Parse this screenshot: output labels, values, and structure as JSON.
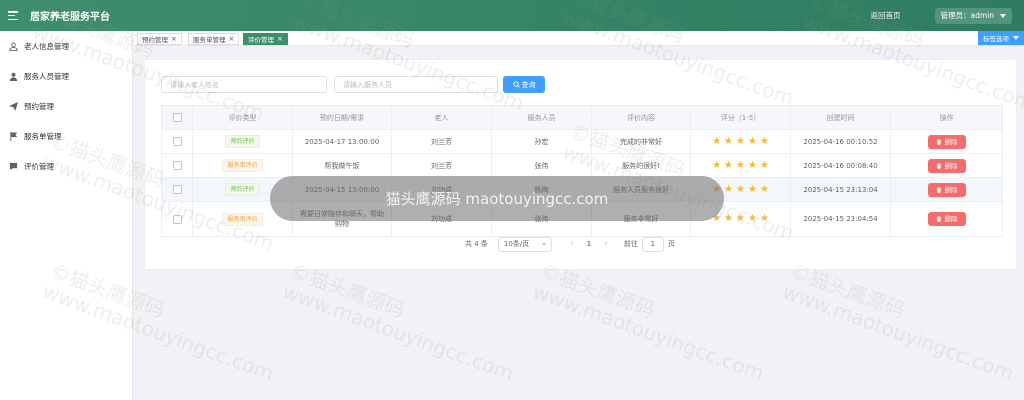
{
  "header": {
    "title": "居家养老服务平台",
    "home_link": "返回首页",
    "user_label": "管理员：admin"
  },
  "sidebar": {
    "items": [
      {
        "label": "老人信息管理",
        "icon": "user-icon"
      },
      {
        "label": "服务人员管理",
        "icon": "person-icon"
      },
      {
        "label": "预约管理",
        "icon": "send-icon"
      },
      {
        "label": "服务单管理",
        "icon": "flag-icon"
      },
      {
        "label": "评价管理",
        "icon": "comment-icon"
      }
    ]
  },
  "tabs": [
    {
      "label": "预约管理",
      "active": false
    },
    {
      "label": "服务单管理",
      "active": false
    },
    {
      "label": "评价管理",
      "active": true
    }
  ],
  "tab_options_label": "标签选项",
  "filters": {
    "elder_placeholder": "请输入老人姓名",
    "staff_placeholder": "请输入服务人员",
    "search_label": "查询"
  },
  "table": {
    "columns": [
      "评价类型",
      "预约日期/需求",
      "老人",
      "服务人员",
      "评价内容",
      "评分（1-5）",
      "创建时间",
      "操作"
    ],
    "rows": [
      {
        "type": "预约评价",
        "type_color": "green",
        "date_need": "2025-04-17 13:00:00",
        "elder": "刘兰芳",
        "staff": "孙宏",
        "content": "完成的非常好",
        "rating": 5,
        "created": "2025-04-16 00:10:52",
        "action": "删除"
      },
      {
        "type": "服务单评价",
        "type_color": "orange",
        "date_need": "帮我做午饭",
        "elder": "刘兰芳",
        "staff": "张伟",
        "content": "服务的很好!",
        "rating": 5,
        "created": "2025-04-16 00:08:40",
        "action": "删除"
      },
      {
        "type": "预约评价",
        "type_color": "green",
        "date_need": "2025-04-15 13:00:00",
        "elder": "刘功成",
        "staff": "杨梅",
        "content": "服务人员服务很好",
        "rating": 5,
        "created": "2025-04-15 23:13:04",
        "action": "删除"
      },
      {
        "type": "服务单评价",
        "type_color": "orange",
        "date_need": "需要日常陪伴和聊天，帮助购物",
        "elder": "刘功成",
        "staff": "张伟",
        "content": "服务非常好",
        "rating": 5,
        "created": "2025-04-15 23:04:54",
        "action": "删除"
      }
    ]
  },
  "pagination": {
    "total_text": "共 4 条",
    "page_size": "10条/页",
    "current_page": "1",
    "goto_label": "前往",
    "goto_value": "1",
    "page_unit": "页"
  },
  "watermark": {
    "text": "©猫头鹰源码",
    "url": "www.maotouyingcc.com",
    "pill_text": "猫头鹰源码 maotouyingcc.com"
  },
  "colors": {
    "header_green": "#3e8e6e",
    "primary_blue": "#409eff",
    "danger_red": "#f56c6c",
    "star_yellow": "#f7ba2a"
  }
}
